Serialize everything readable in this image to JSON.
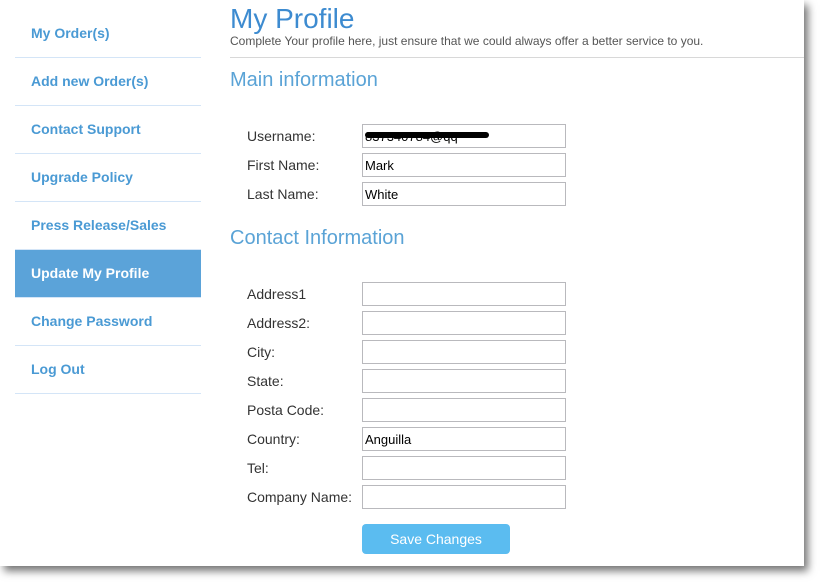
{
  "sidebar": {
    "items": [
      {
        "label": "My Order(s)",
        "active": false
      },
      {
        "label": "Add new Order(s)",
        "active": false
      },
      {
        "label": "Contact Support",
        "active": false
      },
      {
        "label": "Upgrade Policy",
        "active": false
      },
      {
        "label": "Press Release/Sales",
        "active": false
      },
      {
        "label": "Update My Profile",
        "active": true
      },
      {
        "label": "Change Password",
        "active": false
      },
      {
        "label": "Log Out",
        "active": false
      }
    ]
  },
  "header": {
    "title": "My Profile",
    "subtitle": "Complete Your profile here, just ensure that we could always offer a better service to you."
  },
  "main_info": {
    "title": "Main information",
    "fields": [
      {
        "label": "Username:",
        "value": "837340784@qq",
        "redacted": true
      },
      {
        "label": "First Name:",
        "value": "Mark"
      },
      {
        "label": "Last Name:",
        "value": "White"
      }
    ]
  },
  "contact_info": {
    "title": "Contact Information",
    "fields": [
      {
        "label": "Address1",
        "value": ""
      },
      {
        "label": "Address2:",
        "value": ""
      },
      {
        "label": "City:",
        "value": ""
      },
      {
        "label": "State:",
        "value": ""
      },
      {
        "label": "Posta Code:",
        "value": ""
      },
      {
        "label": "Country:",
        "value": "Anguilla"
      },
      {
        "label": "Tel:",
        "value": ""
      },
      {
        "label": "Company Name:",
        "value": ""
      }
    ]
  },
  "actions": {
    "save_label": "Save Changes"
  },
  "colors": {
    "accent": "#5ba3d9",
    "link": "#4a9ad4",
    "title": "#3d8bd0",
    "button": "#5bbcf0"
  }
}
